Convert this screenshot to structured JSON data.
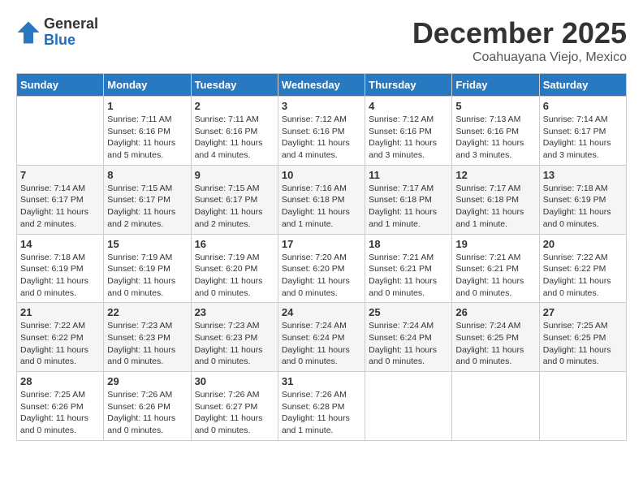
{
  "header": {
    "logo": {
      "general": "General",
      "blue": "Blue"
    },
    "title": "December 2025",
    "location": "Coahuayana Viejo, Mexico"
  },
  "days_of_week": [
    "Sunday",
    "Monday",
    "Tuesday",
    "Wednesday",
    "Thursday",
    "Friday",
    "Saturday"
  ],
  "weeks": [
    [
      {
        "day": "",
        "sunrise": "",
        "sunset": "",
        "daylight": ""
      },
      {
        "day": "1",
        "sunrise": "7:11 AM",
        "sunset": "6:16 PM",
        "daylight": "11 hours and 5 minutes."
      },
      {
        "day": "2",
        "sunrise": "7:11 AM",
        "sunset": "6:16 PM",
        "daylight": "11 hours and 4 minutes."
      },
      {
        "day": "3",
        "sunrise": "7:12 AM",
        "sunset": "6:16 PM",
        "daylight": "11 hours and 4 minutes."
      },
      {
        "day": "4",
        "sunrise": "7:12 AM",
        "sunset": "6:16 PM",
        "daylight": "11 hours and 3 minutes."
      },
      {
        "day": "5",
        "sunrise": "7:13 AM",
        "sunset": "6:16 PM",
        "daylight": "11 hours and 3 minutes."
      },
      {
        "day": "6",
        "sunrise": "7:14 AM",
        "sunset": "6:17 PM",
        "daylight": "11 hours and 3 minutes."
      }
    ],
    [
      {
        "day": "7",
        "sunrise": "7:14 AM",
        "sunset": "6:17 PM",
        "daylight": "11 hours and 2 minutes."
      },
      {
        "day": "8",
        "sunrise": "7:15 AM",
        "sunset": "6:17 PM",
        "daylight": "11 hours and 2 minutes."
      },
      {
        "day": "9",
        "sunrise": "7:15 AM",
        "sunset": "6:17 PM",
        "daylight": "11 hours and 2 minutes."
      },
      {
        "day": "10",
        "sunrise": "7:16 AM",
        "sunset": "6:18 PM",
        "daylight": "11 hours and 1 minute."
      },
      {
        "day": "11",
        "sunrise": "7:17 AM",
        "sunset": "6:18 PM",
        "daylight": "11 hours and 1 minute."
      },
      {
        "day": "12",
        "sunrise": "7:17 AM",
        "sunset": "6:18 PM",
        "daylight": "11 hours and 1 minute."
      },
      {
        "day": "13",
        "sunrise": "7:18 AM",
        "sunset": "6:19 PM",
        "daylight": "11 hours and 0 minutes."
      }
    ],
    [
      {
        "day": "14",
        "sunrise": "7:18 AM",
        "sunset": "6:19 PM",
        "daylight": "11 hours and 0 minutes."
      },
      {
        "day": "15",
        "sunrise": "7:19 AM",
        "sunset": "6:19 PM",
        "daylight": "11 hours and 0 minutes."
      },
      {
        "day": "16",
        "sunrise": "7:19 AM",
        "sunset": "6:20 PM",
        "daylight": "11 hours and 0 minutes."
      },
      {
        "day": "17",
        "sunrise": "7:20 AM",
        "sunset": "6:20 PM",
        "daylight": "11 hours and 0 minutes."
      },
      {
        "day": "18",
        "sunrise": "7:21 AM",
        "sunset": "6:21 PM",
        "daylight": "11 hours and 0 minutes."
      },
      {
        "day": "19",
        "sunrise": "7:21 AM",
        "sunset": "6:21 PM",
        "daylight": "11 hours and 0 minutes."
      },
      {
        "day": "20",
        "sunrise": "7:22 AM",
        "sunset": "6:22 PM",
        "daylight": "11 hours and 0 minutes."
      }
    ],
    [
      {
        "day": "21",
        "sunrise": "7:22 AM",
        "sunset": "6:22 PM",
        "daylight": "11 hours and 0 minutes."
      },
      {
        "day": "22",
        "sunrise": "7:23 AM",
        "sunset": "6:23 PM",
        "daylight": "11 hours and 0 minutes."
      },
      {
        "day": "23",
        "sunrise": "7:23 AM",
        "sunset": "6:23 PM",
        "daylight": "11 hours and 0 minutes."
      },
      {
        "day": "24",
        "sunrise": "7:24 AM",
        "sunset": "6:24 PM",
        "daylight": "11 hours and 0 minutes."
      },
      {
        "day": "25",
        "sunrise": "7:24 AM",
        "sunset": "6:24 PM",
        "daylight": "11 hours and 0 minutes."
      },
      {
        "day": "26",
        "sunrise": "7:24 AM",
        "sunset": "6:25 PM",
        "daylight": "11 hours and 0 minutes."
      },
      {
        "day": "27",
        "sunrise": "7:25 AM",
        "sunset": "6:25 PM",
        "daylight": "11 hours and 0 minutes."
      }
    ],
    [
      {
        "day": "28",
        "sunrise": "7:25 AM",
        "sunset": "6:26 PM",
        "daylight": "11 hours and 0 minutes."
      },
      {
        "day": "29",
        "sunrise": "7:26 AM",
        "sunset": "6:26 PM",
        "daylight": "11 hours and 0 minutes."
      },
      {
        "day": "30",
        "sunrise": "7:26 AM",
        "sunset": "6:27 PM",
        "daylight": "11 hours and 0 minutes."
      },
      {
        "day": "31",
        "sunrise": "7:26 AM",
        "sunset": "6:28 PM",
        "daylight": "11 hours and 1 minute."
      },
      {
        "day": "",
        "sunrise": "",
        "sunset": "",
        "daylight": ""
      },
      {
        "day": "",
        "sunrise": "",
        "sunset": "",
        "daylight": ""
      },
      {
        "day": "",
        "sunrise": "",
        "sunset": "",
        "daylight": ""
      }
    ]
  ],
  "labels": {
    "sunrise": "Sunrise:",
    "sunset": "Sunset:",
    "daylight": "Daylight:"
  }
}
